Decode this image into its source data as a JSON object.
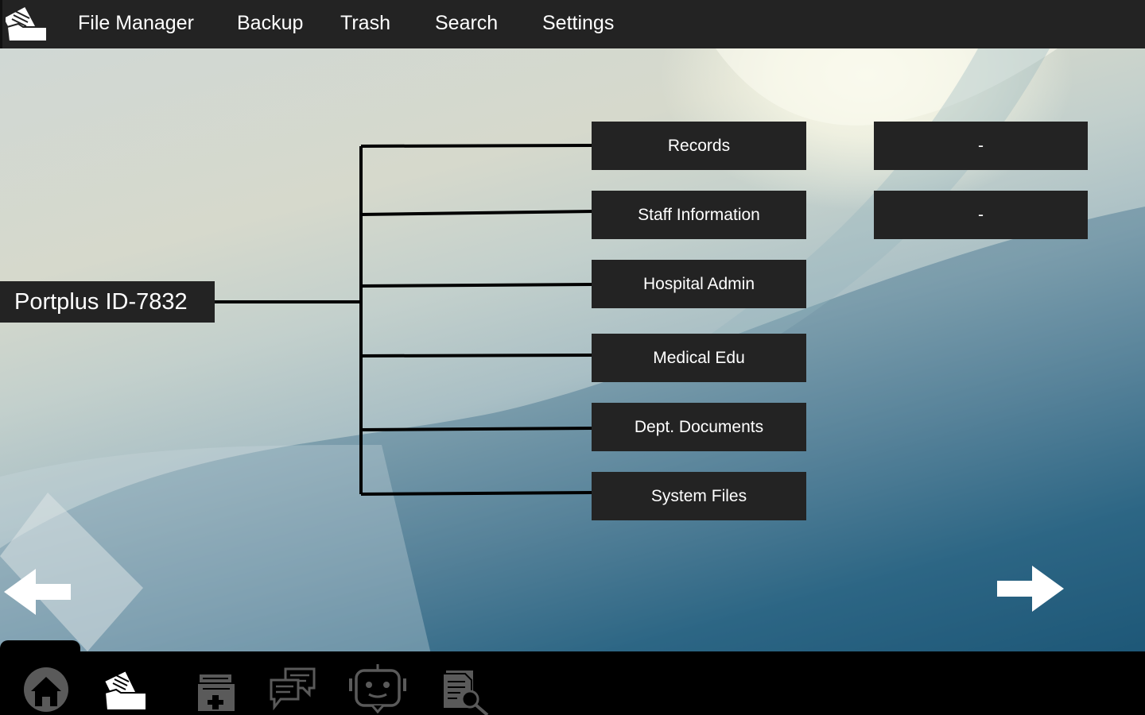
{
  "app": {
    "nav": {
      "file_manager": "File Manager",
      "backup": "Backup",
      "trash": "Trash",
      "search": "Search",
      "settings": "Settings"
    }
  },
  "tree": {
    "root_label": "Portplus ID-7832",
    "folders": [
      {
        "label": "Records"
      },
      {
        "label": "Staff Information"
      },
      {
        "label": "Hospital Admin"
      },
      {
        "label": "Medical Edu"
      },
      {
        "label": "Dept. Documents"
      },
      {
        "label": "System Files"
      }
    ],
    "subfolders": [
      {
        "label": "-"
      },
      {
        "label": "-"
      }
    ]
  },
  "dock": {
    "icons": [
      "home-icon",
      "file-folder-icon",
      "medical-file-icon",
      "chat-icon",
      "robot-icon",
      "document-search-icon"
    ]
  },
  "colors": {
    "panel": "#232323",
    "dock": "#000000",
    "text": "#ffffff",
    "icon_gray": "#5a5a5a"
  }
}
